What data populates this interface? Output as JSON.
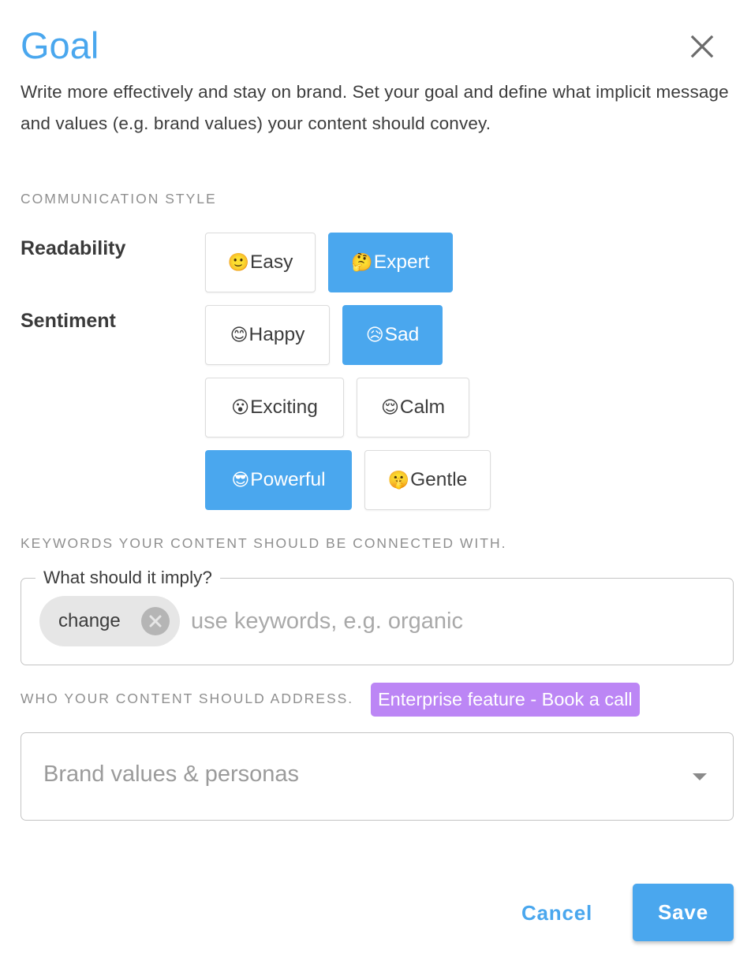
{
  "dialog": {
    "title": "Goal",
    "close_icon": "close-icon",
    "description": "Write more effectively and stay on brand. Set your goal and define what implicit message and values (e.g. brand values) your content should convey."
  },
  "communication_style": {
    "section_label": "COMMUNICATION STYLE",
    "readability": {
      "label": "Readability",
      "options": [
        {
          "emoji": "🙂",
          "label": "Easy",
          "selected": false
        },
        {
          "emoji": "🤔",
          "label": "Expert",
          "selected": true
        }
      ]
    },
    "sentiment": {
      "label": "Sentiment",
      "options": [
        {
          "emoji": "😊",
          "label": "Happy",
          "selected": false
        },
        {
          "emoji": "😥",
          "label": "Sad",
          "selected": true
        },
        {
          "emoji": "😮",
          "label": "Exciting",
          "selected": false
        },
        {
          "emoji": "😌",
          "label": "Calm",
          "selected": false
        },
        {
          "emoji": "😎",
          "label": "Powerful",
          "selected": true
        },
        {
          "emoji": "🤫",
          "label": "Gentle",
          "selected": false
        }
      ]
    }
  },
  "keywords": {
    "section_label": "KEYWORDS YOUR CONTENT SHOULD BE CONNECTED WITH.",
    "field_label": "What should it imply?",
    "chips": [
      {
        "label": "change"
      }
    ],
    "input_value": "",
    "placeholder": "use keywords, e.g. organic"
  },
  "audience": {
    "section_label": "WHO YOUR CONTENT SHOULD ADDRESS.",
    "badge": "Enterprise feature - Book a call",
    "select_placeholder": "Brand values & personas"
  },
  "actions": {
    "cancel_label": "Cancel",
    "save_label": "Save"
  },
  "colors": {
    "accent": "#4aa7ee",
    "badge": "#bc86f5",
    "chip": "#e6e6e6"
  }
}
